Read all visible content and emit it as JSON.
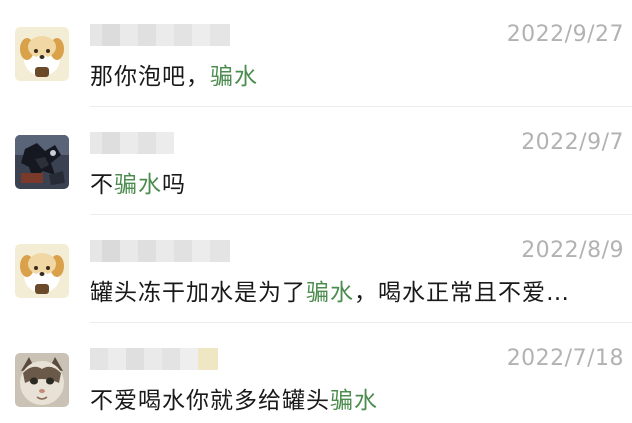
{
  "conversations": [
    {
      "date": "2022/9/27",
      "message_parts": [
        "那你泡吧，",
        "骗水",
        ""
      ],
      "avatar_icon": "dog-cartoon-avatar-icon"
    },
    {
      "date": "2022/9/7",
      "message_parts": [
        "不",
        "骗水",
        "吗"
      ],
      "avatar_icon": "dark-anime-avatar-icon"
    },
    {
      "date": "2022/8/9",
      "message_parts": [
        "罐头冻干加水是为了",
        "骗水",
        "，喝水正常且不爱…"
      ],
      "avatar_icon": "dog-cartoon-avatar-icon"
    },
    {
      "date": "2022/7/18",
      "message_parts": [
        "不爱喝水你就多给罐头",
        "骗水",
        ""
      ],
      "avatar_icon": "cat-photo-avatar-icon"
    }
  ],
  "colors": {
    "highlight": "#4c8d4f",
    "date": "#b2b2b2",
    "text": "#191919"
  }
}
